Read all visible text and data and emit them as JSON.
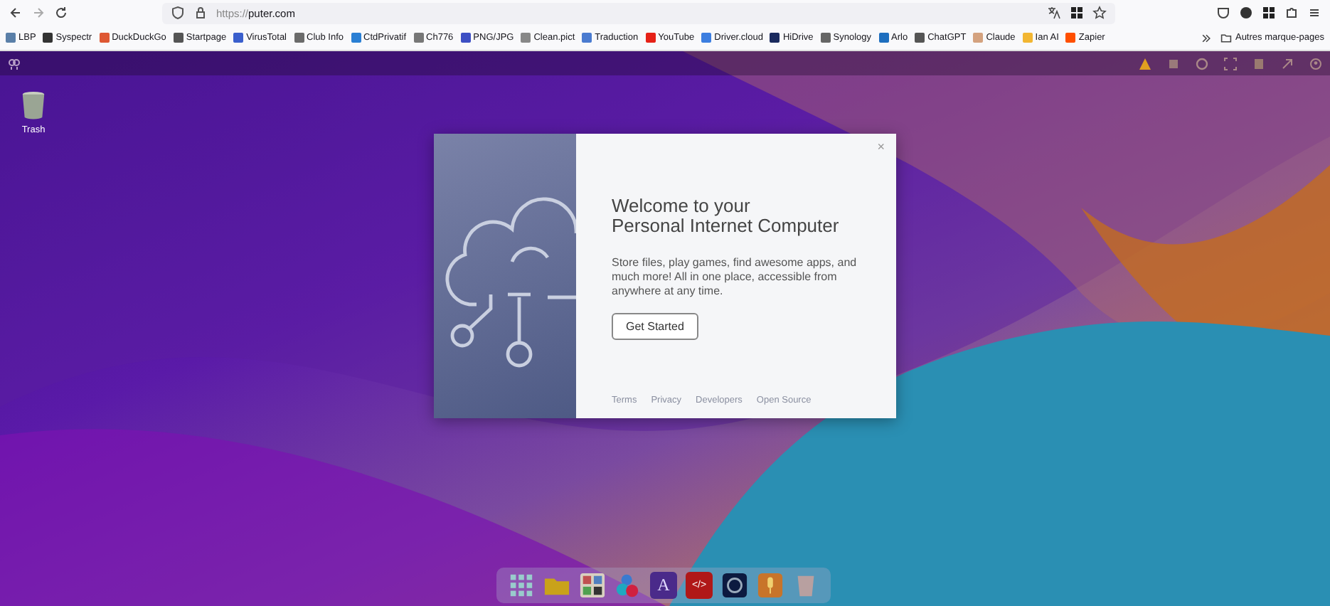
{
  "browser": {
    "url_prefix": "https://",
    "url_host": "puter.com"
  },
  "bookmarks": [
    {
      "label": "LBP",
      "color": "#5a7fa8"
    },
    {
      "label": "Syspectr",
      "color": "#333333"
    },
    {
      "label": "DuckDuckGo",
      "color": "#de5833"
    },
    {
      "label": "Startpage",
      "color": "#555555"
    },
    {
      "label": "VirusTotal",
      "color": "#3a5fcd"
    },
    {
      "label": "Club Info",
      "color": "#6b6b6b"
    },
    {
      "label": "CtdPrivatif",
      "color": "#2a7fd4"
    },
    {
      "label": "Ch776",
      "color": "#777777"
    },
    {
      "label": "PNG/JPG",
      "color": "#3d4fc4"
    },
    {
      "label": "Clean.pict",
      "color": "#888888"
    },
    {
      "label": "Traduction",
      "color": "#4a7bd0"
    },
    {
      "label": "YouTube",
      "color": "#e62117"
    },
    {
      "label": "Driver.cloud",
      "color": "#3c7ee0"
    },
    {
      "label": "HiDrive",
      "color": "#1a2a5e"
    },
    {
      "label": "Synology",
      "color": "#666666"
    },
    {
      "label": "Arlo",
      "color": "#1e6fbf"
    },
    {
      "label": "ChatGPT",
      "color": "#555555"
    },
    {
      "label": "Claude",
      "color": "#d4a27f"
    },
    {
      "label": "Ian AI",
      "color": "#f2b632"
    },
    {
      "label": "Zapier",
      "color": "#ff4f00"
    }
  ],
  "other_bookmarks": "Autres marque-pages",
  "desktop": {
    "items": [
      {
        "label": "Trash"
      }
    ]
  },
  "dialog": {
    "title_lines": [
      "Welcome to your",
      "Personal Internet Computer"
    ],
    "description": "Store files, play games, find awesome apps, and much more! All in one place, accessible from anywhere at any time.",
    "button": "Get Started",
    "close": "×",
    "links": [
      "Terms",
      "Privacy",
      "Developers",
      "Open Source"
    ]
  },
  "dock": [
    {
      "kind": "grid"
    },
    {
      "kind": "folder"
    },
    {
      "kind": "apps"
    },
    {
      "kind": "circles"
    },
    {
      "kind": "letter",
      "label": "A"
    },
    {
      "kind": "code",
      "label": "</>"
    },
    {
      "kind": "ring"
    },
    {
      "kind": "mic"
    },
    {
      "kind": "trash"
    }
  ]
}
